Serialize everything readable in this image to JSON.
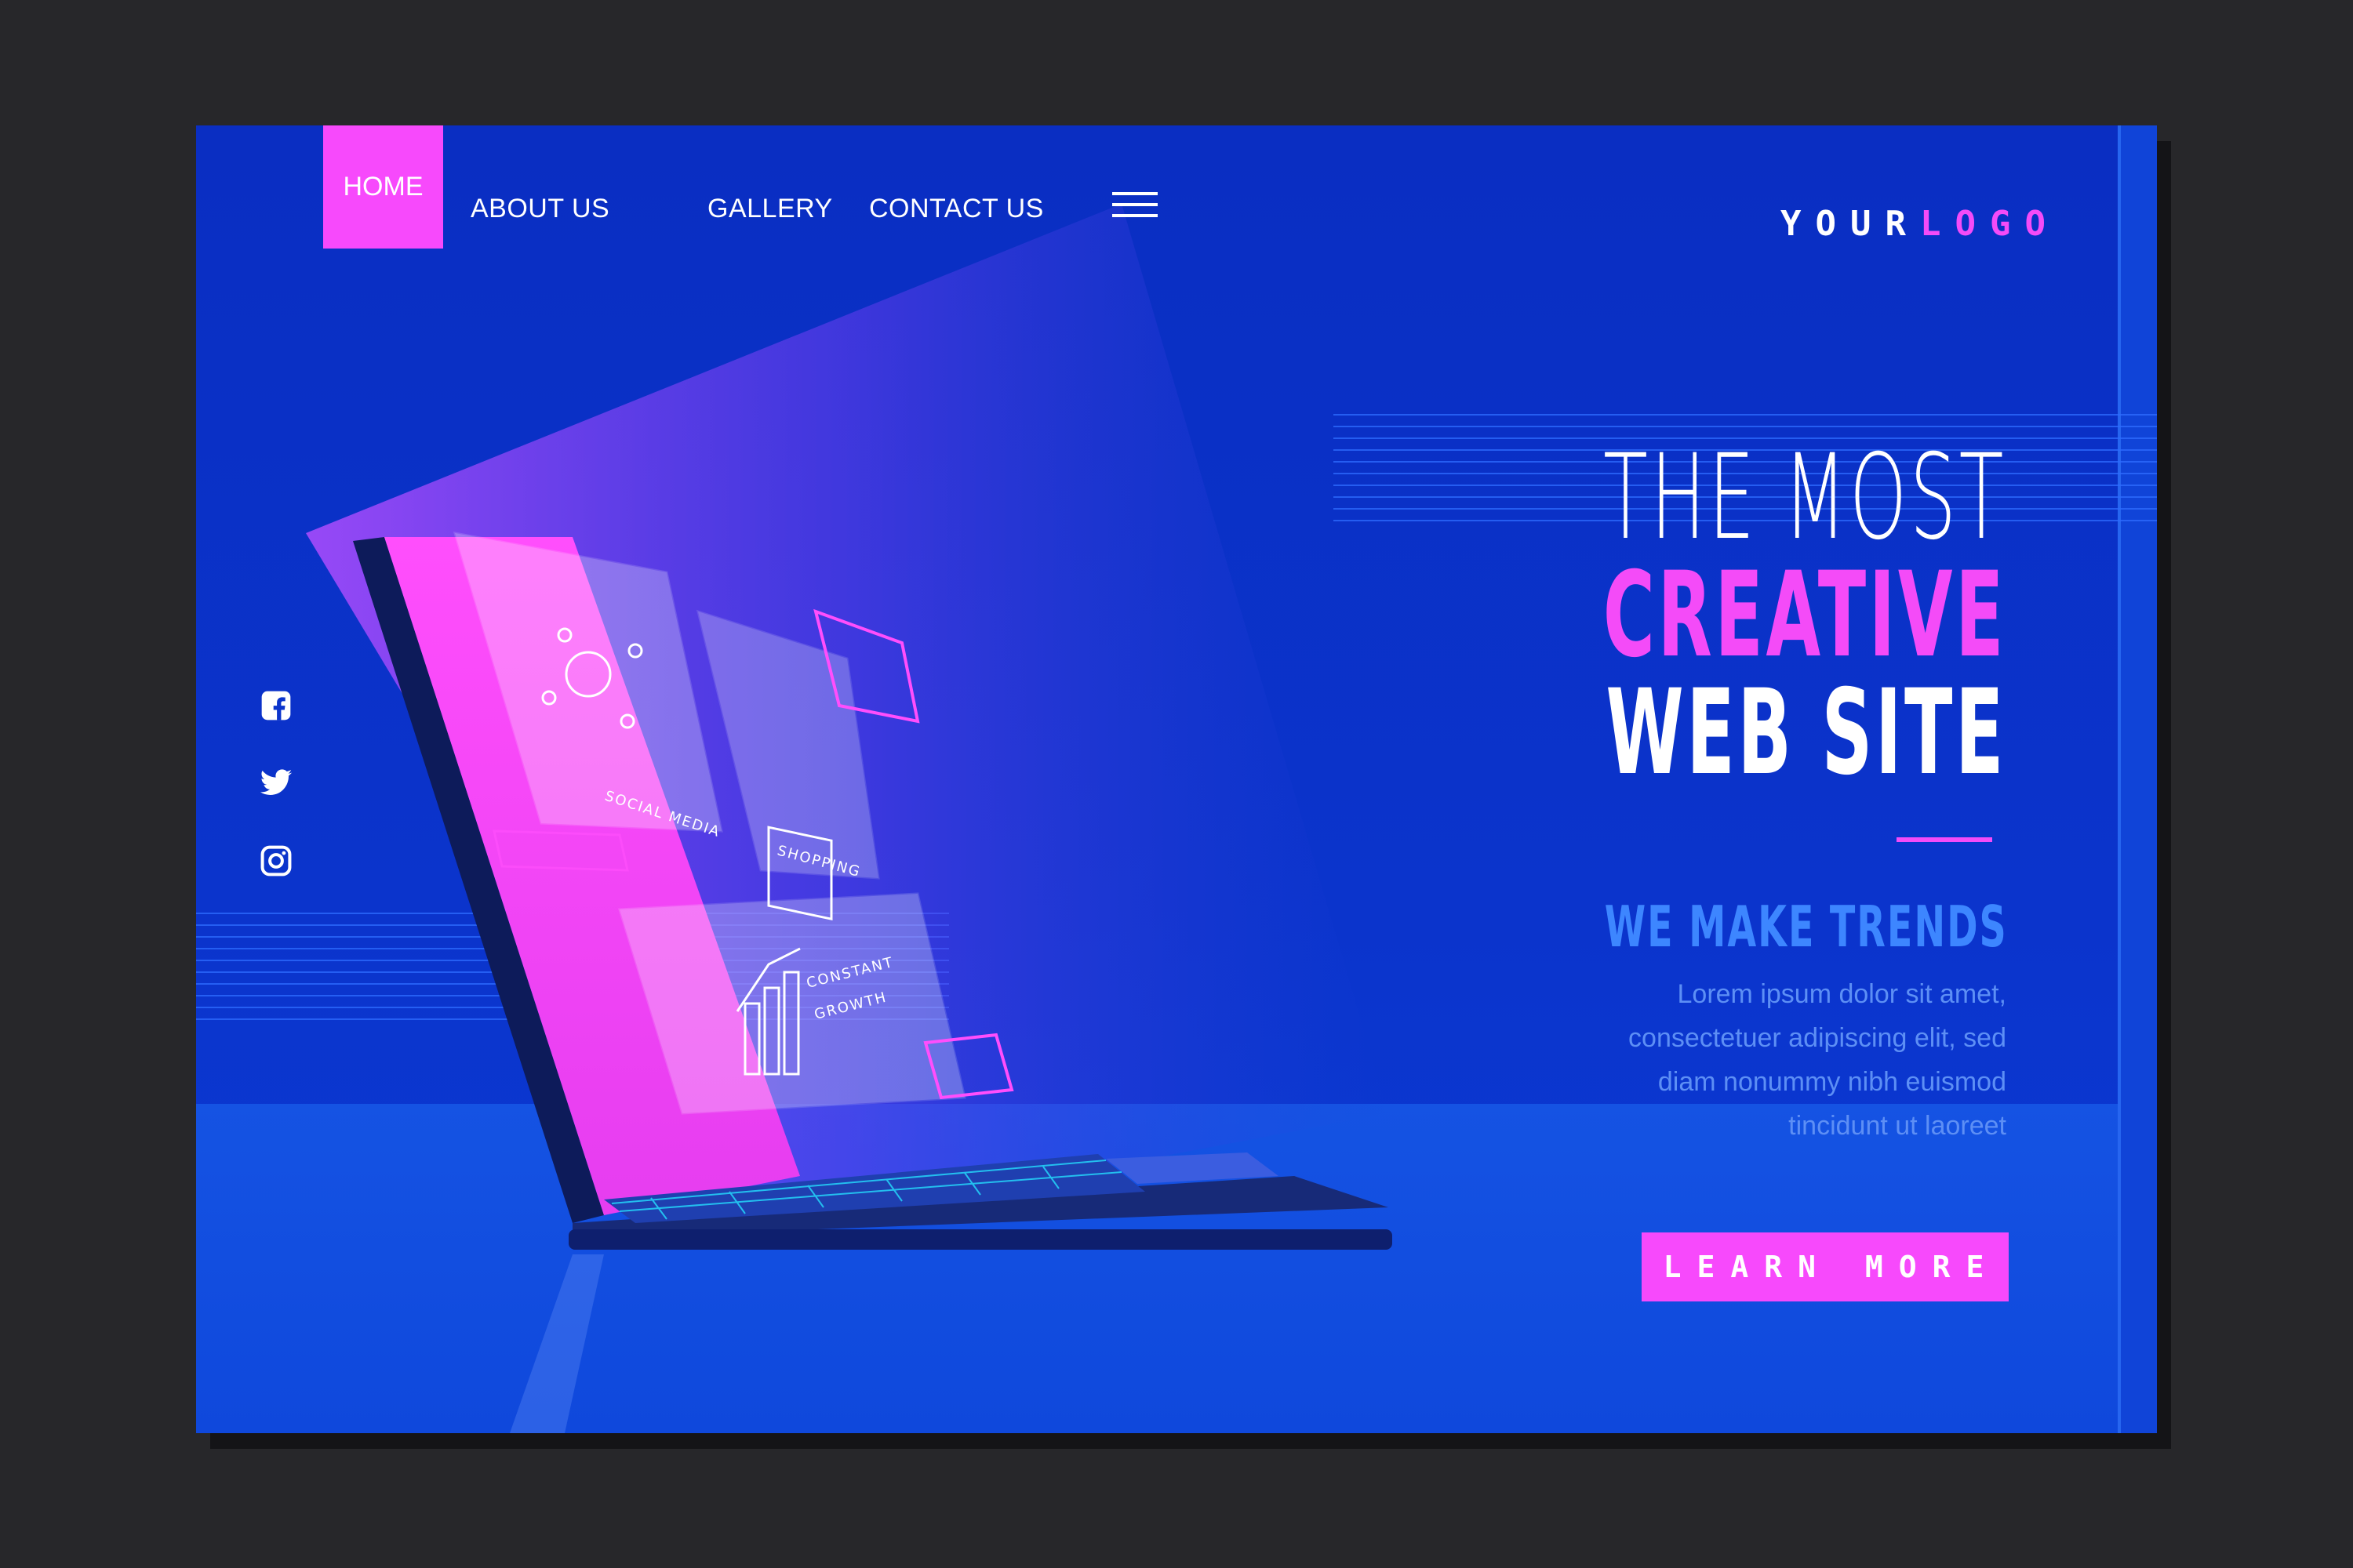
{
  "nav": {
    "items": [
      {
        "label": "HOME",
        "active": true
      },
      {
        "label": "ABOUT US"
      },
      {
        "label": "GALLERY"
      },
      {
        "label": "CONTACT US"
      }
    ],
    "menu_icon": "hamburger-icon"
  },
  "logo": {
    "part1": "YOUR",
    "part2": "LOGO"
  },
  "social": [
    "facebook-icon",
    "twitter-icon",
    "instagram-icon"
  ],
  "hero": {
    "line1": "THE MOST",
    "line2": "CREATIVE",
    "line3": "WEB SITE",
    "subtitle": "WE MAKE TRENDS",
    "body": [
      "Lorem ipsum dolor sit amet,",
      "consectetuer adipiscing elit, sed",
      "diam nonummy nibh euismod",
      "tincidunt ut laoreet"
    ],
    "cta": "LEARN MORE"
  },
  "tiles": {
    "social": "SOCIAL MEDIA",
    "shopping": "SHOPPING",
    "growth_1": "CONSTANT",
    "growth_2": "GROWTH"
  },
  "colors": {
    "background": "#0a2ec2",
    "accent": "#f749fc",
    "subtitle": "#3d86ff",
    "frame": "#27272a"
  }
}
